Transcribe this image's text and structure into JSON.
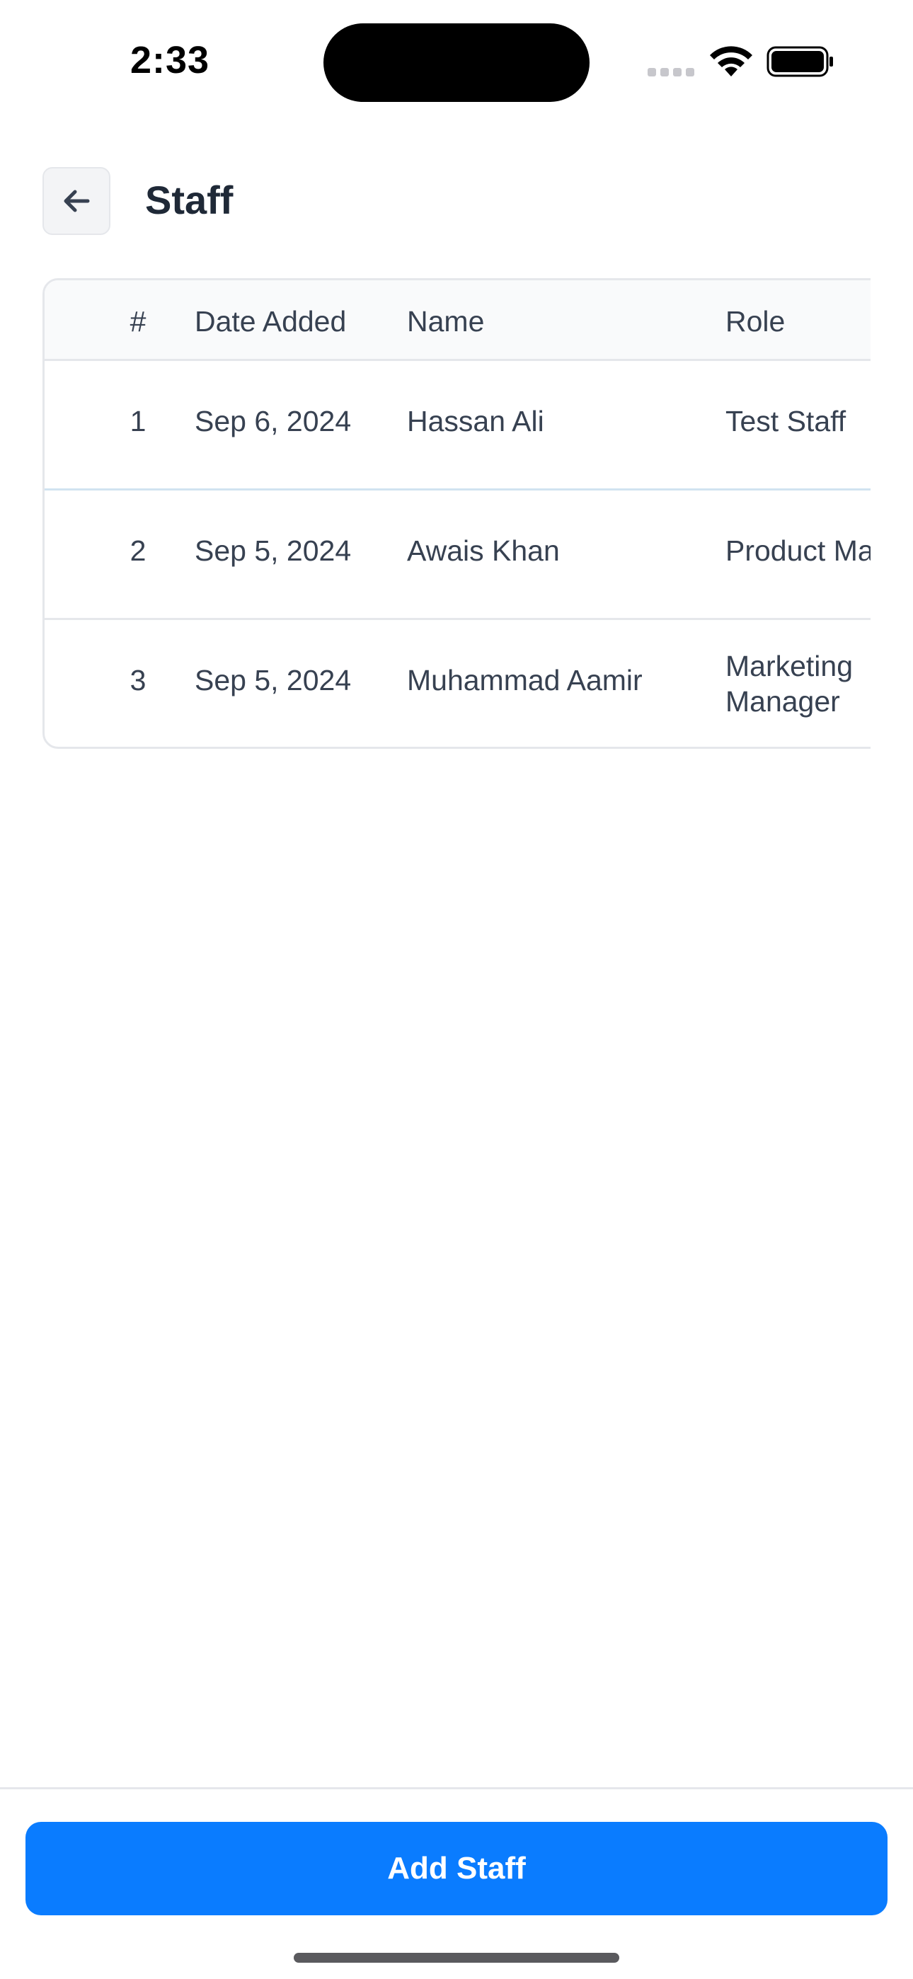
{
  "status_bar": {
    "time": "2:33"
  },
  "header": {
    "back_icon": "arrow-left-icon",
    "title": "Staff"
  },
  "table": {
    "columns": [
      "#",
      "Date Added",
      "Name",
      "Role"
    ],
    "rows": [
      {
        "num": "1",
        "date_added": "Sep 6, 2024",
        "name": "Hassan Ali",
        "role": "Test Staff"
      },
      {
        "num": "2",
        "date_added": "Sep 5, 2024",
        "name": "Awais Khan",
        "role": "Product Ma"
      },
      {
        "num": "3",
        "date_added": "Sep 5, 2024",
        "name": "Muhammad Aamir",
        "role": "Marketing Manager"
      }
    ]
  },
  "footer": {
    "add_label": "Add Staff"
  },
  "colors": {
    "primary": "#0a7cff",
    "text": "#1f2937",
    "border": "#e5e7eb",
    "header_bg": "#f9fafb"
  }
}
